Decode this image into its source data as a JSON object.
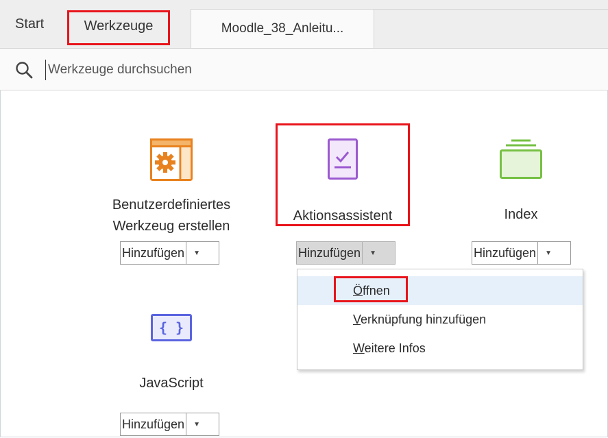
{
  "tabs": [
    {
      "label": "Start"
    },
    {
      "label": "Werkzeuge"
    },
    {
      "label": "Moodle_38_Anleitu..."
    }
  ],
  "search": {
    "placeholder": "Werkzeuge durchsuchen"
  },
  "tools": [
    {
      "label_line1": "Benutzerdefiniertes",
      "label_line2": "Werkzeug erstellen",
      "button": "Hinzufügen",
      "icon": "custom-tool-gear-icon",
      "color": "#e8821e"
    },
    {
      "label": "Aktionsassistent",
      "button": "Hinzufügen",
      "icon": "action-wizard-checklist-icon",
      "color": "#9b59d0"
    },
    {
      "label": "Index",
      "button": "Hinzufügen",
      "icon": "index-stack-icon",
      "color": "#76c043"
    },
    {
      "label": "JavaScript",
      "button": "Hinzufügen",
      "icon": "javascript-braces-icon",
      "color": "#5a64e0",
      "icon_text": "{ }"
    }
  ],
  "menu": {
    "items": [
      {
        "first": "Ö",
        "rest": "ffnen"
      },
      {
        "first": "V",
        "rest": "erknüpfung hinzufügen"
      },
      {
        "first": "W",
        "rest": "eitere Infos"
      }
    ]
  },
  "colors": {
    "highlight_box": "#e8141b",
    "menu_hover": "#e6f0fa",
    "tabbar": "#eeeeee"
  }
}
